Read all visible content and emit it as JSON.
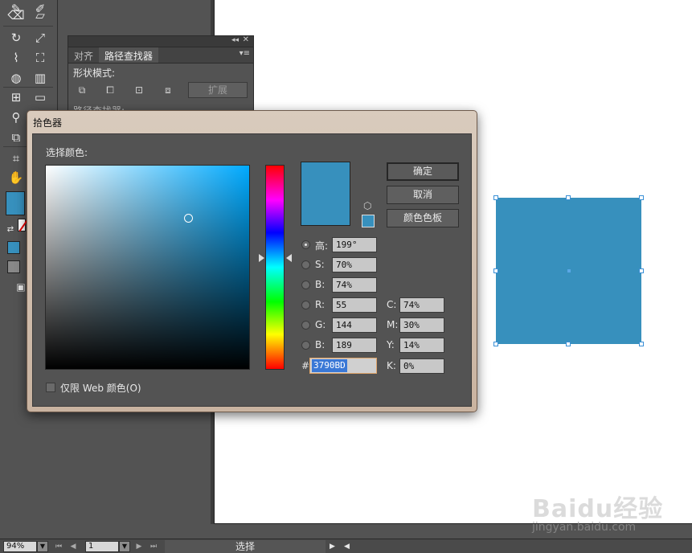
{
  "colors": {
    "accent": "#3790BD",
    "panel": "#535353",
    "canvas": "#ffffff"
  },
  "tools": {
    "icons": [
      "pencil-icon",
      "eraser-icon",
      "rotate-icon",
      "scale-icon",
      "warp-icon",
      "free-transform-icon",
      "shape-builder-icon",
      "graph-icon",
      "mesh-icon",
      "gradient-icon",
      "eyedropper-icon",
      "blend-icon",
      "artboard-icon",
      "slice-icon",
      "hand-icon",
      "zoom-icon"
    ]
  },
  "pathfinder": {
    "tabs": [
      "对齐",
      "路径查找器"
    ],
    "shape_modes_label": "形状模式:",
    "pathfinders_label": "路径查找器:",
    "expand_label": "扩展"
  },
  "dialog": {
    "title": "拾色器",
    "select_label": "选择颜色:",
    "ok_label": "确定",
    "cancel_label": "取消",
    "swatches_label": "颜色色板",
    "h_label": "高:",
    "h_value": "199°",
    "s_label": "S:",
    "s_value": "70%",
    "b_label": "B:",
    "b_value": "74%",
    "r_label": "R:",
    "r_value": "55",
    "g_label": "G:",
    "g_value": "144",
    "bl_label": "B:",
    "bl_value": "189",
    "c_label": "C:",
    "c_value": "74%",
    "m_label": "M:",
    "m_value": "30%",
    "y_label": "Y:",
    "y_value": "14%",
    "k_label": "K:",
    "k_value": "0%",
    "hex_label": "#",
    "hex_value": "3790BD",
    "web_only_label": "仅限 Web 颜色(O)"
  },
  "status": {
    "zoom": "94%",
    "page": "1",
    "tool": "选择"
  },
  "watermark": {
    "logo": "Baidu经验",
    "url": "jingyan.baidu.com"
  }
}
